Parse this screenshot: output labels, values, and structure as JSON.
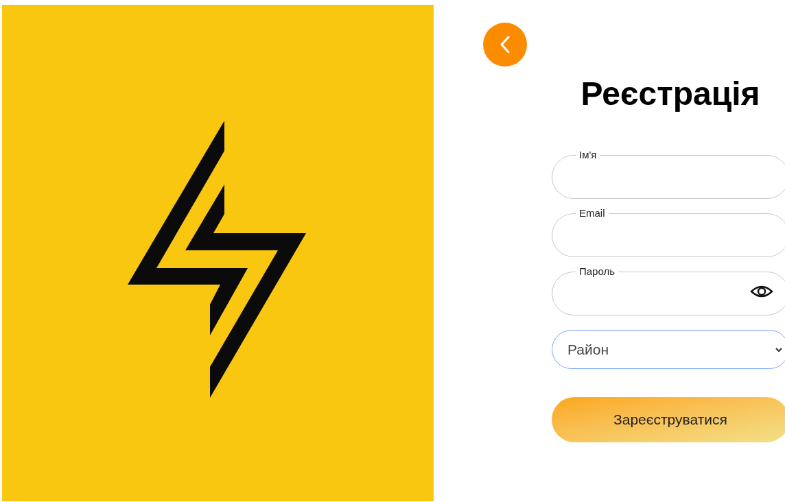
{
  "title": "Реєстрація",
  "fields": [
    {
      "kind": "text",
      "label": "Ім'я"
    },
    {
      "kind": "email",
      "label": "Email"
    },
    {
      "kind": "password",
      "label": "Пароль"
    }
  ],
  "district_select": {
    "value": "Район",
    "focused": true
  },
  "submit_button": "Зареєструватися"
}
